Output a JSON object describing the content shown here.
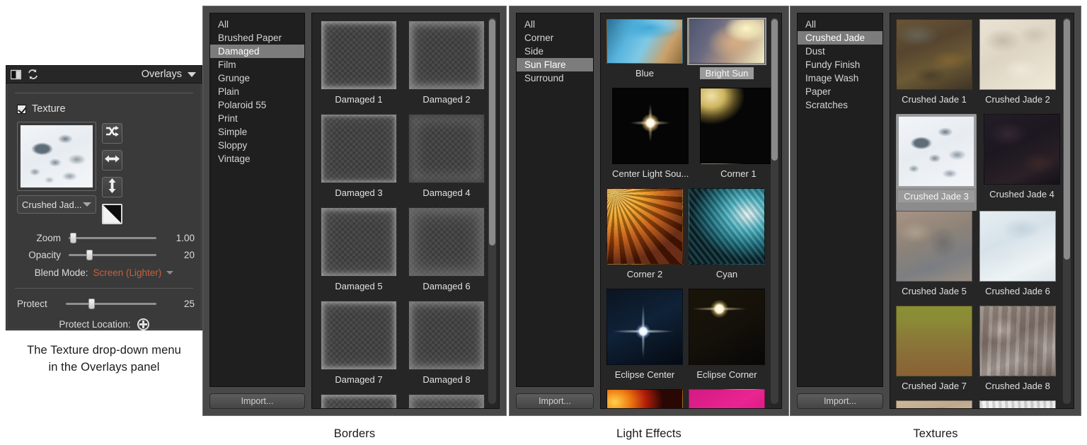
{
  "overlays_panel": {
    "title": "Overlays",
    "icons": {
      "split_view": "split-view-icon",
      "reset": "reset-icon",
      "caret": "chevron-down-icon"
    },
    "texture": {
      "checkbox_label": "Texture",
      "checked": true,
      "dropdown_value": "Crushed Jad...",
      "buttons": [
        "shuffle-icon",
        "flip-horizontal-icon",
        "flip-vertical-icon",
        "invert-icon"
      ]
    },
    "sliders": [
      {
        "label": "Zoom",
        "value": "1.00",
        "percent": 2
      },
      {
        "label": "Opacity",
        "value": "20",
        "percent": 20
      }
    ],
    "blend": {
      "label": "Blend Mode:",
      "value": "Screen (Lighter)",
      "color": "#c8603c"
    },
    "protect": {
      "label": "Protect",
      "value": "25",
      "percent": 25
    },
    "protect_location": {
      "label": "Protect Location:",
      "icon": "target-icon"
    }
  },
  "captions": {
    "overlays": "The Texture drop-down menu\nin the Overlays panel",
    "overlays_line1": "The Texture drop-down menu",
    "overlays_line2": "in the Overlays panel",
    "borders": "Borders",
    "light_effects": "Light Effects",
    "textures": "Textures"
  },
  "borders_panel": {
    "categories": [
      "All",
      "Brushed Paper",
      "Damaged",
      "Film",
      "Grunge",
      "Plain",
      "Polaroid 55",
      "Print",
      "Simple",
      "Sloppy",
      "Vintage"
    ],
    "selected_category": "Damaged",
    "import_label": "Import...",
    "thumbnails": [
      {
        "label": "Damaged  1",
        "style": "b1"
      },
      {
        "label": "Damaged  2",
        "style": "b2"
      },
      {
        "label": "Damaged  3",
        "style": "b3"
      },
      {
        "label": "Damaged  4",
        "style": "b4"
      },
      {
        "label": "Damaged  5",
        "style": "b5"
      },
      {
        "label": "Damaged  6",
        "style": "b6"
      },
      {
        "label": "Damaged  7",
        "style": "b7"
      },
      {
        "label": "Damaged  8",
        "style": "b8"
      }
    ],
    "selected_thumbnail": null
  },
  "light_effects_panel": {
    "categories": [
      "All",
      "Corner",
      "Side",
      "Sun Flare",
      "Surround"
    ],
    "selected_category": "Sun Flare",
    "import_label": "Import...",
    "thumbnails": [
      {
        "label": "Blue"
      },
      {
        "label": "Bright Sun"
      },
      {
        "label": "Center Light Sou..."
      },
      {
        "label": "Corner 1"
      },
      {
        "label": "Corner 2"
      },
      {
        "label": "Cyan"
      },
      {
        "label": "Eclipse Center"
      },
      {
        "label": "Eclipse Corner"
      }
    ],
    "selected_thumbnail": "Bright Sun"
  },
  "textures_panel": {
    "categories": [
      "All",
      "Crushed Jade",
      "Dust",
      "Fundy Finish",
      "Image Wash",
      "Paper",
      "Scratches"
    ],
    "selected_category": "Crushed Jade",
    "import_label": "Import...",
    "thumbnails": [
      {
        "label": "Crushed Jade  1"
      },
      {
        "label": "Crushed Jade  2"
      },
      {
        "label": "Crushed Jade  3"
      },
      {
        "label": "Crushed Jade  4"
      },
      {
        "label": "Crushed Jade  5"
      },
      {
        "label": "Crushed Jade  6"
      },
      {
        "label": "Crushed Jade  7"
      },
      {
        "label": "Crushed Jade  8"
      }
    ],
    "selected_thumbnail": "Crushed Jade  3"
  }
}
